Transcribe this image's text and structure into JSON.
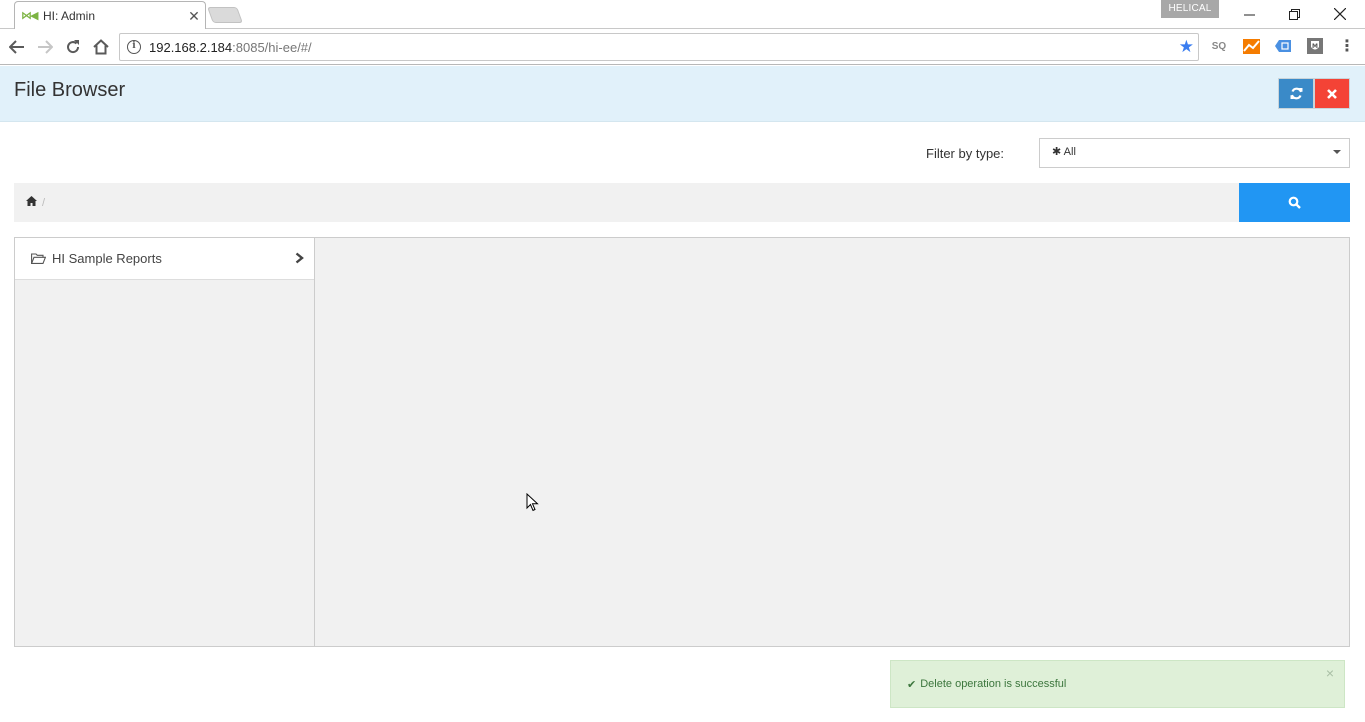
{
  "browser": {
    "tab_title": "HI: Admin",
    "profile_name": "HELICAL",
    "url_host": "192.168.2.184",
    "url_rest": ":8085/hi-ee/#/",
    "extensions": [
      "sq-extension-icon",
      "analytics-extension-icon",
      "tag-extension-icon",
      "shield-extension-icon"
    ]
  },
  "app": {
    "page_title": "File Browser",
    "buttons": {
      "refresh": "refresh-icon",
      "close": "close-icon",
      "search": "search-icon"
    },
    "filter": {
      "label": "Filter by type:",
      "selected": "All",
      "selected_icon": "asterisk-icon"
    },
    "breadcrumb": {
      "separator": "/"
    },
    "tree": {
      "items": [
        {
          "label": "HI Sample Reports",
          "icon": "folder-open-icon"
        }
      ]
    },
    "toast": {
      "message": "Delete operation is successful",
      "type": "success",
      "color": "#3c763d",
      "background": "#dff0d8"
    }
  }
}
